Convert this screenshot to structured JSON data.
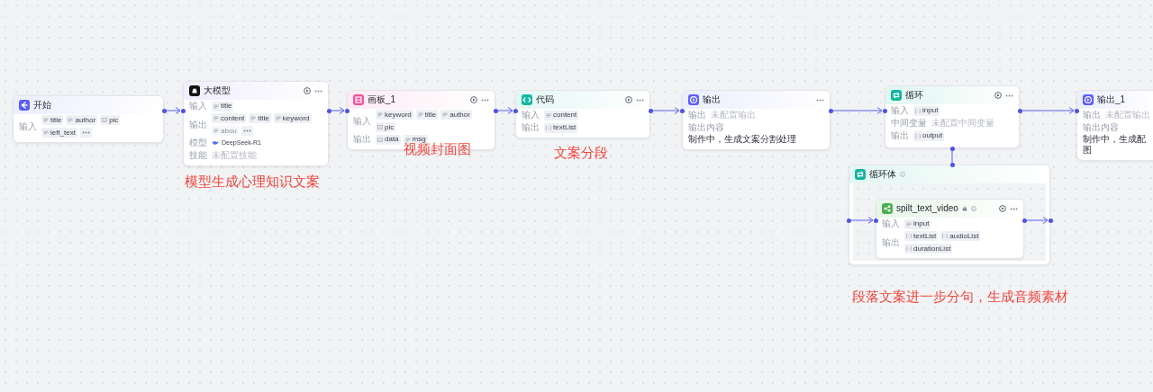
{
  "canvas": {
    "nodes": [
      {
        "title": "开始",
        "kind": "start",
        "run_button": false,
        "more_button": false,
        "rows": [
          {
            "kind": "tags",
            "label": "输入",
            "more": true,
            "tags": [
              {
                "text": "title",
                "kind": "string",
                "faded": false
              },
              {
                "text": "author",
                "kind": "string",
                "faded": false
              },
              {
                "text": "pic",
                "kind": "image",
                "faded": false
              },
              {
                "text": "left_text",
                "kind": "string",
                "faded": false
              }
            ]
          }
        ]
      },
      {
        "title": "大模型",
        "kind": "llm",
        "run_button": true,
        "more_button": true,
        "rows": [
          {
            "kind": "tags",
            "label": "输入",
            "more": false,
            "tags": [
              {
                "text": "title",
                "kind": "string",
                "faded": false
              }
            ]
          },
          {
            "kind": "tags",
            "label": "输出",
            "more": true,
            "tags": [
              {
                "text": "content",
                "kind": "string",
                "faded": false
              },
              {
                "text": "title",
                "kind": "string",
                "faded": false
              },
              {
                "text": "keyword",
                "kind": "string",
                "faded": false
              },
              {
                "text": "abou",
                "kind": "string",
                "faded": true
              }
            ]
          },
          {
            "kind": "model",
            "label": "模型",
            "value": "DeepSeek-R1"
          },
          {
            "kind": "text",
            "label": "技能",
            "value": "未配置技能",
            "muted": true
          }
        ]
      },
      {
        "title": "画板_1",
        "kind": "board",
        "run_button": true,
        "more_button": true,
        "rows": [
          {
            "kind": "tags",
            "label": "输入",
            "more": false,
            "tags": [
              {
                "text": "keyword",
                "kind": "string",
                "faded": false
              },
              {
                "text": "title",
                "kind": "string",
                "faded": false
              },
              {
                "text": "author",
                "kind": "string",
                "faded": false
              },
              {
                "text": "pic",
                "kind": "image",
                "faded": false
              }
            ]
          },
          {
            "kind": "tags",
            "label": "输出",
            "more": false,
            "tags": [
              {
                "text": "data",
                "kind": "image",
                "faded": false
              },
              {
                "text": "msg",
                "kind": "string",
                "faded": false
              }
            ]
          }
        ]
      },
      {
        "title": "代码",
        "kind": "code",
        "run_button": true,
        "more_button": true,
        "rows": [
          {
            "kind": "tags",
            "label": "输入",
            "more": false,
            "tags": [
              {
                "text": "content",
                "kind": "string",
                "faded": false
              }
            ]
          },
          {
            "kind": "tags",
            "label": "输出",
            "more": false,
            "tags": [
              {
                "text": "textList",
                "kind": "array",
                "faded": false
              }
            ]
          }
        ]
      },
      {
        "title": "输出",
        "kind": "output",
        "run_button": false,
        "more_button": true,
        "rows": [
          {
            "kind": "text",
            "label": "输出",
            "value": "未配置输出",
            "muted": true
          },
          {
            "kind": "text",
            "label": "输出内容",
            "value": "制作中，生成文案分割处理",
            "muted": false
          }
        ]
      },
      {
        "title": "循环",
        "kind": "loop",
        "run_button": true,
        "more_button": true,
        "rows": [
          {
            "kind": "tags",
            "label": "输入",
            "more": false,
            "tags": [
              {
                "text": "input",
                "kind": "array",
                "faded": false
              }
            ]
          },
          {
            "kind": "text",
            "label": "中间变量",
            "value": "未配置中间变量",
            "muted": true
          },
          {
            "kind": "tags",
            "label": "输出",
            "more": false,
            "tags": [
              {
                "text": "output",
                "kind": "array",
                "faded": false
              }
            ]
          }
        ]
      },
      {
        "title": "输出_1",
        "kind": "output",
        "run_button": false,
        "more_button": false,
        "rows": [
          {
            "kind": "text",
            "label": "输出",
            "value": "未配置输出",
            "muted": true
          },
          {
            "kind": "text",
            "label": "输出内容",
            "value": "制作中，生成配图",
            "muted": false
          }
        ]
      }
    ],
    "loop_body": {
      "title": "循环体",
      "node": {
        "title": "spilt_text_video",
        "kind": "workflow",
        "run_button": true,
        "more_button": true,
        "rows": [
          {
            "kind": "tags",
            "label": "输入",
            "more": false,
            "tags": [
              {
                "text": "input",
                "kind": "string",
                "faded": false
              }
            ]
          },
          {
            "kind": "tags",
            "label": "输出",
            "more": false,
            "tags": [
              {
                "text": "textList",
                "kind": "array",
                "faded": false
              },
              {
                "text": "audioList",
                "kind": "array",
                "faded": false
              },
              {
                "text": "durationList",
                "kind": "array",
                "faded": false
              }
            ]
          }
        ]
      }
    },
    "annotations": [
      "模型生成心理知识文案",
      "视频封面图",
      "文案分段",
      "段落文案进一步分句，生成音频素材"
    ]
  }
}
